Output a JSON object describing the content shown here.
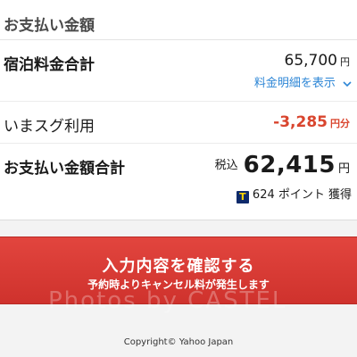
{
  "payment": {
    "section_title": "お支払い金額",
    "accommodation_total_label": "宿泊料金合計",
    "accommodation_total_value": "65,700",
    "currency_small": "円",
    "breakdown_link_label": "料金明細を表示",
    "discount_label": "いまスグ利用",
    "discount_value": "-3,285",
    "discount_unit": "円分",
    "grand_total_label": "お支払い金額合計",
    "tax_label": "税込",
    "grand_total_value": "62,415",
    "points_icon_text": "T",
    "points_text": "624 ポイント 獲得"
  },
  "confirm_button": {
    "label": "入力内容を確認する",
    "sublabel": "予約時よりキャンセル料が発生します"
  },
  "watermark": "Photos by CASTEL",
  "footer": {
    "copyright": "Copyright© Yahoo Japan"
  },
  "colors": {
    "link": "#2d86d6",
    "discount": "#d9452e",
    "button": "#d63a35"
  }
}
